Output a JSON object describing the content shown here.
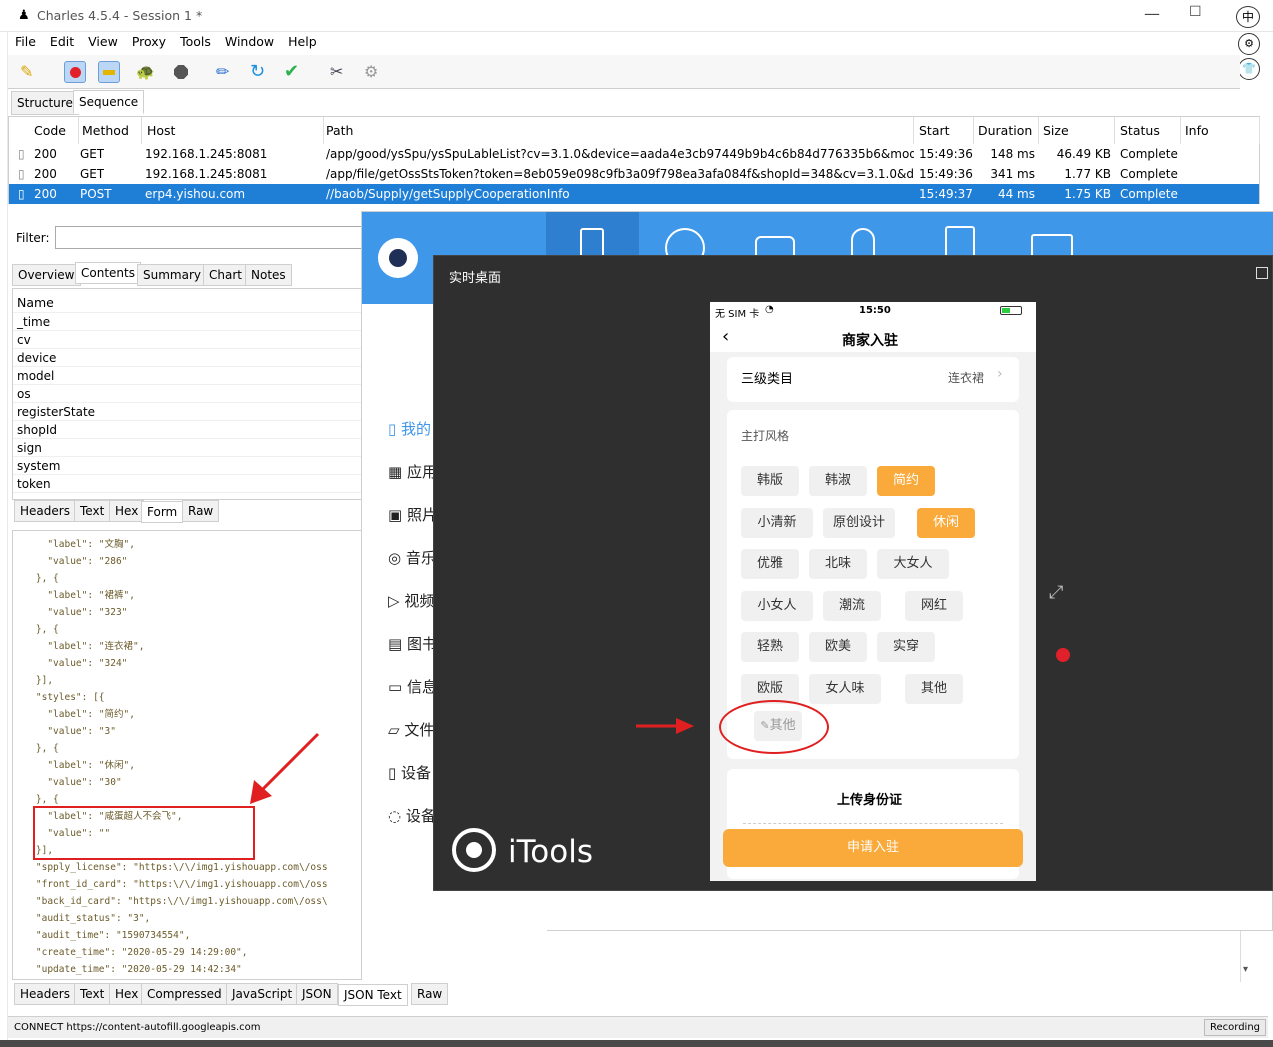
{
  "window": {
    "title": "Charles 4.5.4 - Session 1 *"
  },
  "menu": [
    "File",
    "Edit",
    "View",
    "Proxy",
    "Tools",
    "Window",
    "Help"
  ],
  "toolbar_icons": [
    "broom-icon",
    "record-icon",
    "throttle-icon",
    "turtle-icon",
    "stop-icon",
    "pen-icon",
    "refresh-icon",
    "check-icon",
    "tools-icon",
    "gear-icon"
  ],
  "view_tabs": [
    "Structure",
    "Sequence"
  ],
  "table": {
    "headers": [
      "Code",
      "Method",
      "Host",
      "Path",
      "Start",
      "Duration",
      "Size",
      "Status",
      "Info"
    ],
    "rows": [
      [
        "200",
        "GET",
        "192.168.1.245:8081",
        "/app/good/ysSpu/ysSpuLableList?cv=3.1.0&device=aada4e3cb97449b9b4c6b84d776335b6&mode...",
        "15:49:36",
        "148 ms",
        "46.49 KB",
        "Complete",
        ""
      ],
      [
        "200",
        "GET",
        "192.168.1.245:8081",
        "/app/file/getOssStsToken?token=8eb059e098c9fb3a09f798ea3afa084f&shopId=348&cv=3.1.0&de...",
        "15:49:36",
        "341 ms",
        "1.77 KB",
        "Complete",
        ""
      ],
      [
        "200",
        "POST",
        "erp4.yishou.com",
        "//baob/Supply/getSupplyCooperationInfo",
        "15:49:37",
        "44 ms",
        "1.75 KB",
        "Complete",
        ""
      ]
    ]
  },
  "filter": {
    "label": "Filter:"
  },
  "detail_tabs": [
    "Overview",
    "Contents",
    "Summary",
    "Chart",
    "Notes"
  ],
  "name_panel": {
    "header": "Name",
    "items": [
      "_time",
      "cv",
      "device",
      "model",
      "os",
      "registerState",
      "shopId",
      "sign",
      "system",
      "token"
    ]
  },
  "request_tabs": [
    "Headers",
    "Text",
    "Hex",
    "Form",
    "Raw"
  ],
  "json_lines": [
    "      \"label\": \"文胸\",",
    "      \"value\": \"286\"",
    "    }, {",
    "      \"label\": \"裙裤\",",
    "      \"value\": \"323\"",
    "    }, {",
    "      \"label\": \"连衣裙\",",
    "      \"value\": \"324\"",
    "    }],",
    "    \"styles\": [{",
    "      \"label\": \"简约\",",
    "      \"value\": \"3\"",
    "    }, {",
    "      \"label\": \"休闲\",",
    "      \"value\": \"30\"",
    "    }, {",
    "      \"label\": \"咸蛋超人不会飞\",",
    "      \"value\": \"\"",
    "    }],",
    "    \"spply_license\": \"https:\\/\\/img1.yishouapp.com\\/oss",
    "    \"front_id_card\": \"https:\\/\\/img1.yishouapp.com\\/oss",
    "    \"back_id_card\": \"https:\\/\\/img1.yishouapp.com\\/oss\\",
    "    \"audit_status\": \"3\",",
    "    \"audit_time\": \"1590734554\",",
    "    \"create_time\": \"2020-05-29 14:29:00\",",
    "    \"update_time\": \"2020-05-29 14:42:34\""
  ],
  "response_tabs": [
    "Headers",
    "Text",
    "Hex",
    "Compressed",
    "JavaScript",
    "JSON",
    "JSON Text",
    "Raw"
  ],
  "status": {
    "left": "CONNECT https://content-autofill.googleapis.com",
    "right": "Recording"
  },
  "itools": {
    "logo_text": "iTools",
    "nav": [
      "我的",
      "应用",
      "照片",
      "音乐",
      "视频",
      "图书",
      "信息",
      "文件",
      "设备",
      "设备"
    ],
    "live_title": "实时桌面"
  },
  "phone": {
    "status_left": "无 SIM 卡",
    "time": "15:50",
    "title": "商家入驻",
    "category_label": "三级类目",
    "category_value": "连衣裙",
    "style_label": "主打风格",
    "chips": [
      "韩版",
      "韩淑",
      "简约",
      "小清新",
      "原创设计",
      "休闲",
      "优雅",
      "北味",
      "大女人",
      "小女人",
      "潮流",
      "网红",
      "轻熟",
      "欧美",
      "实穿",
      "欧版",
      "女人味",
      "其他"
    ],
    "selected_chips": [
      "简约",
      "休闲"
    ],
    "custom_chip": "其他",
    "upload_label": "上传身份证",
    "submit": "申请入驻"
  },
  "colors": {
    "selection": "#1f7fd7",
    "accent": "#f9aa3a",
    "itools_blue": "#3f97e9",
    "annotation": "#e02020"
  }
}
